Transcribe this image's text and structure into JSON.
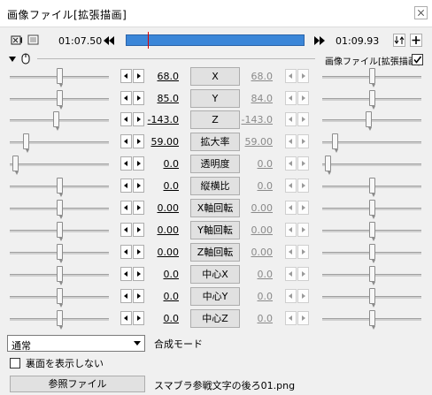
{
  "window": {
    "title": "画像ファイル[拡張描画]"
  },
  "timeline": {
    "start_time": "01:07.50",
    "end_time": "01:09.93",
    "cursor_fraction": 0.12
  },
  "subheader": {
    "object_label": "画像ファイル[拡張描画]",
    "checked": true
  },
  "params": [
    {
      "label": "X",
      "start": "68.0",
      "end": "68.0",
      "slider_start": 0.5,
      "slider_end": 0.5
    },
    {
      "label": "Y",
      "start": "85.0",
      "end": "84.0",
      "slider_start": 0.5,
      "slider_end": 0.5
    },
    {
      "label": "Z",
      "start": "-143.0",
      "end": "-143.0",
      "slider_start": 0.47,
      "slider_end": 0.47
    },
    {
      "label": "拡大率",
      "start": "59.00",
      "end": "59.00",
      "slider_start": 0.14,
      "slider_end": 0.1
    },
    {
      "label": "透明度",
      "start": "0.0",
      "end": "0.0",
      "slider_start": 0.03,
      "slider_end": 0.03
    },
    {
      "label": "縦横比",
      "start": "0.0",
      "end": "0.0",
      "slider_start": 0.5,
      "slider_end": 0.5
    },
    {
      "label": "X軸回転",
      "start": "0.00",
      "end": "0.00",
      "slider_start": 0.5,
      "slider_end": 0.5
    },
    {
      "label": "Y軸回転",
      "start": "0.00",
      "end": "0.00",
      "slider_start": 0.5,
      "slider_end": 0.5
    },
    {
      "label": "Z軸回転",
      "start": "0.00",
      "end": "0.00",
      "slider_start": 0.5,
      "slider_end": 0.5
    },
    {
      "label": "中心X",
      "start": "0.0",
      "end": "0.0",
      "slider_start": 0.5,
      "slider_end": 0.5
    },
    {
      "label": "中心Y",
      "start": "0.0",
      "end": "0.0",
      "slider_start": 0.5,
      "slider_end": 0.5
    },
    {
      "label": "中心Z",
      "start": "0.0",
      "end": "0.0",
      "slider_start": 0.5,
      "slider_end": 0.5
    }
  ],
  "blend": {
    "value": "通常",
    "label": "合成モード"
  },
  "backface": {
    "label": "裏面を表示しない",
    "checked": false
  },
  "file": {
    "button_label": "参照ファイル",
    "filename": "スマブラ参戦文字の後ろ01.png"
  },
  "colors": {
    "seekbar": "#3b86d8",
    "cursor": "#e00000"
  }
}
